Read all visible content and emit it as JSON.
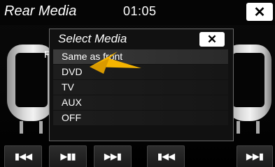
{
  "header": {
    "title": "Rear Media",
    "time": "01:05",
    "close_icon": "close-icon"
  },
  "background": {
    "label": "Pl"
  },
  "dialog": {
    "title": "Select Media",
    "close_icon": "close-icon",
    "options": [
      "Same as front",
      "DVD",
      "TV",
      "AUX",
      "OFF"
    ],
    "highlighted_option": "Same as front"
  },
  "controls": [
    {
      "name": "previous-track-button",
      "glyph": "▮◀◀"
    },
    {
      "name": "play-pause-button",
      "glyph": "▶▮▮"
    },
    {
      "name": "next-track-button",
      "glyph": "▶▶▮"
    },
    {
      "name": "previous-track-button-2",
      "glyph": "▮◀◀"
    },
    {
      "name": "next-track-button-2",
      "glyph": "▶▶▮"
    }
  ],
  "colors": {
    "arrow": "#f5b400",
    "background": "#000000",
    "text": "#ffffff"
  }
}
